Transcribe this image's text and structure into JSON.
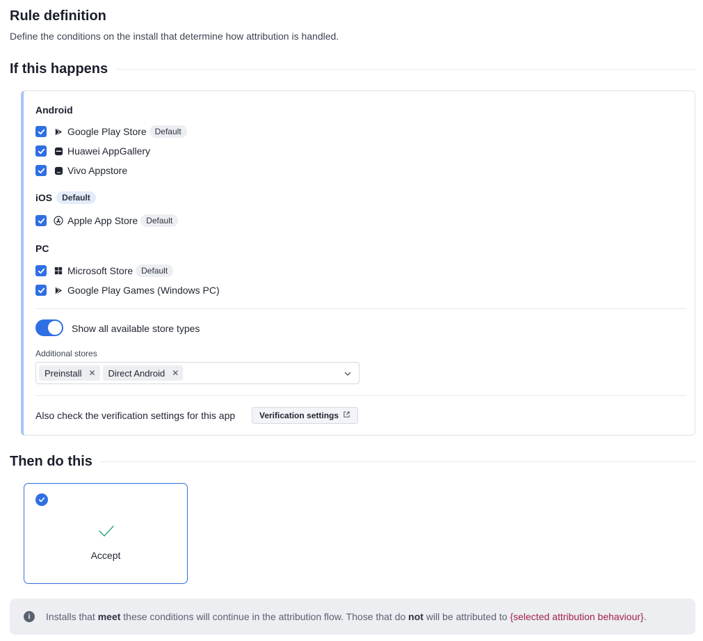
{
  "header": {
    "title": "Rule definition",
    "subtitle": "Define the conditions on the install that determine how attribution is handled."
  },
  "if_section": {
    "title": "If this happens"
  },
  "platforms": {
    "android": {
      "title": "Android",
      "stores": [
        {
          "label": "Google Play Store",
          "badge": "Default",
          "checked": true,
          "icon": "google-play-icon"
        },
        {
          "label": "Huawei AppGallery",
          "badge": "",
          "checked": true,
          "icon": "huawei-icon"
        },
        {
          "label": "Vivo Appstore",
          "badge": "",
          "checked": true,
          "icon": "vivo-icon"
        }
      ]
    },
    "ios": {
      "title": "iOS",
      "badge": "Default",
      "stores": [
        {
          "label": "Apple App Store",
          "badge": "Default",
          "checked": true,
          "icon": "app-store-icon"
        }
      ]
    },
    "pc": {
      "title": "PC",
      "stores": [
        {
          "label": "Microsoft Store",
          "badge": "Default",
          "checked": true,
          "icon": "windows-icon"
        },
        {
          "label": "Google Play Games (Windows PC)",
          "badge": "",
          "checked": true,
          "icon": "google-play-icon"
        }
      ]
    }
  },
  "toggle": {
    "label": "Show all available store types",
    "on": true
  },
  "additional_stores": {
    "label": "Additional stores",
    "chips": [
      "Preinstall",
      "Direct Android"
    ]
  },
  "verification": {
    "text": "Also check the verification settings for this app",
    "button": "Verification settings"
  },
  "then_section": {
    "title": "Then do this"
  },
  "action": {
    "label": "Accept",
    "selected": true
  },
  "info": {
    "part1": "Installs that ",
    "bold1": "meet",
    "part2": " these conditions will continue in the attribution flow. Those that do ",
    "bold2": "not",
    "part3": " will be attributed to ",
    "placeholder": "{selected attribution behaviour}",
    "part4": "."
  },
  "colors": {
    "accent": "#2f6fe3",
    "accept_check": "#2ea882",
    "placeholder": "#a3204a"
  }
}
